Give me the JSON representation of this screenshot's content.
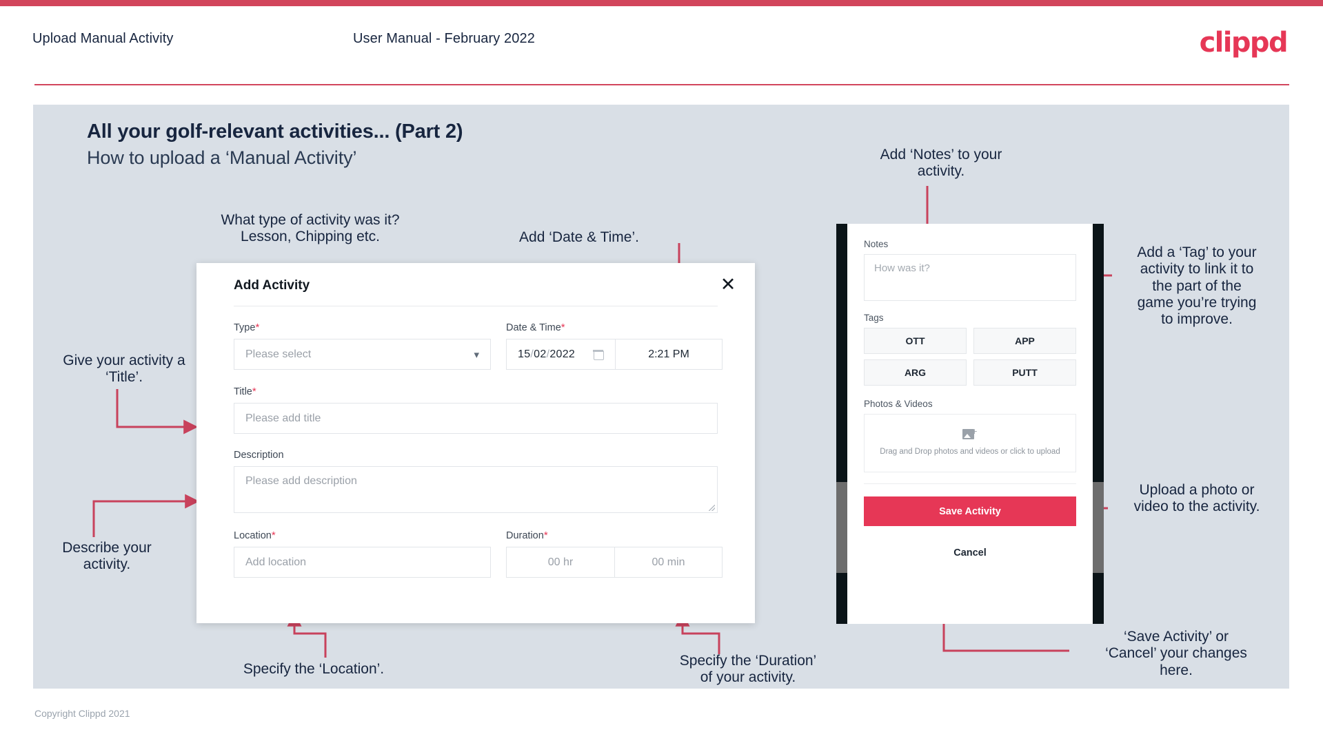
{
  "header": {
    "title": "Upload Manual Activity",
    "subtitle": "User Manual - February 2022",
    "brand": "clippd",
    "accent": "#d2455c"
  },
  "slide": {
    "title": "All your golf-relevant activities... (Part 2)",
    "subtitle": "How to upload a ‘Manual Activity’",
    "background": "#d9dfe6"
  },
  "footer": {
    "copyright": "Copyright Clippd 2021"
  },
  "modal": {
    "title": "Add Activity",
    "close_icon": "close-icon",
    "fields": {
      "type": {
        "label": "Type",
        "required": "*",
        "placeholder": "Please select",
        "chevron": "⌄"
      },
      "datetime": {
        "label": "Date & Time",
        "required": "*",
        "day": "15",
        "month": "02",
        "year": "2022",
        "separator": "/",
        "time": "2:21 PM"
      },
      "title": {
        "label": "Title",
        "required": "*",
        "placeholder": "Please add title"
      },
      "description": {
        "label": "Description",
        "required": "",
        "placeholder": "Please add description"
      },
      "location": {
        "label": "Location",
        "required": "*",
        "placeholder": "Add location"
      },
      "duration": {
        "label": "Duration",
        "required": "*",
        "hours_placeholder": "00 hr",
        "minutes_placeholder": "00 min"
      }
    }
  },
  "phone": {
    "notes": {
      "label": "Notes",
      "placeholder": "How was it?"
    },
    "tags": {
      "label": "Tags",
      "items": [
        "OTT",
        "APP",
        "ARG",
        "PUTT"
      ]
    },
    "photos": {
      "label": "Photos & Videos",
      "dropzone_text": "Drag and Drop photos and videos or\nclick to upload",
      "icon": "add-image-icon"
    },
    "save_label": "Save Activity",
    "cancel_label": "Cancel",
    "save_color": "#e63756"
  },
  "annotations": {
    "type": "What type of activity was it?\nLesson, Chipping etc.",
    "datetime": "Add ‘Date & Time’.",
    "title": "Give your activity a\n‘Title’.",
    "description": "Describe your\nactivity.",
    "location": "Specify the ‘Location’.",
    "duration": "Specify the ‘Duration’\nof your activity.",
    "notes": "Add ‘Notes’ to your\nactivity.",
    "tags": "Add a ‘Tag’ to your\nactivity to link it to\nthe part of the\ngame you’re trying\nto improve.",
    "upload": "Upload a photo or\nvideo to the activity.",
    "save": "‘Save Activity’ or\n‘Cancel’ your changes\nhere.",
    "arrow_color": "#c8425c"
  }
}
